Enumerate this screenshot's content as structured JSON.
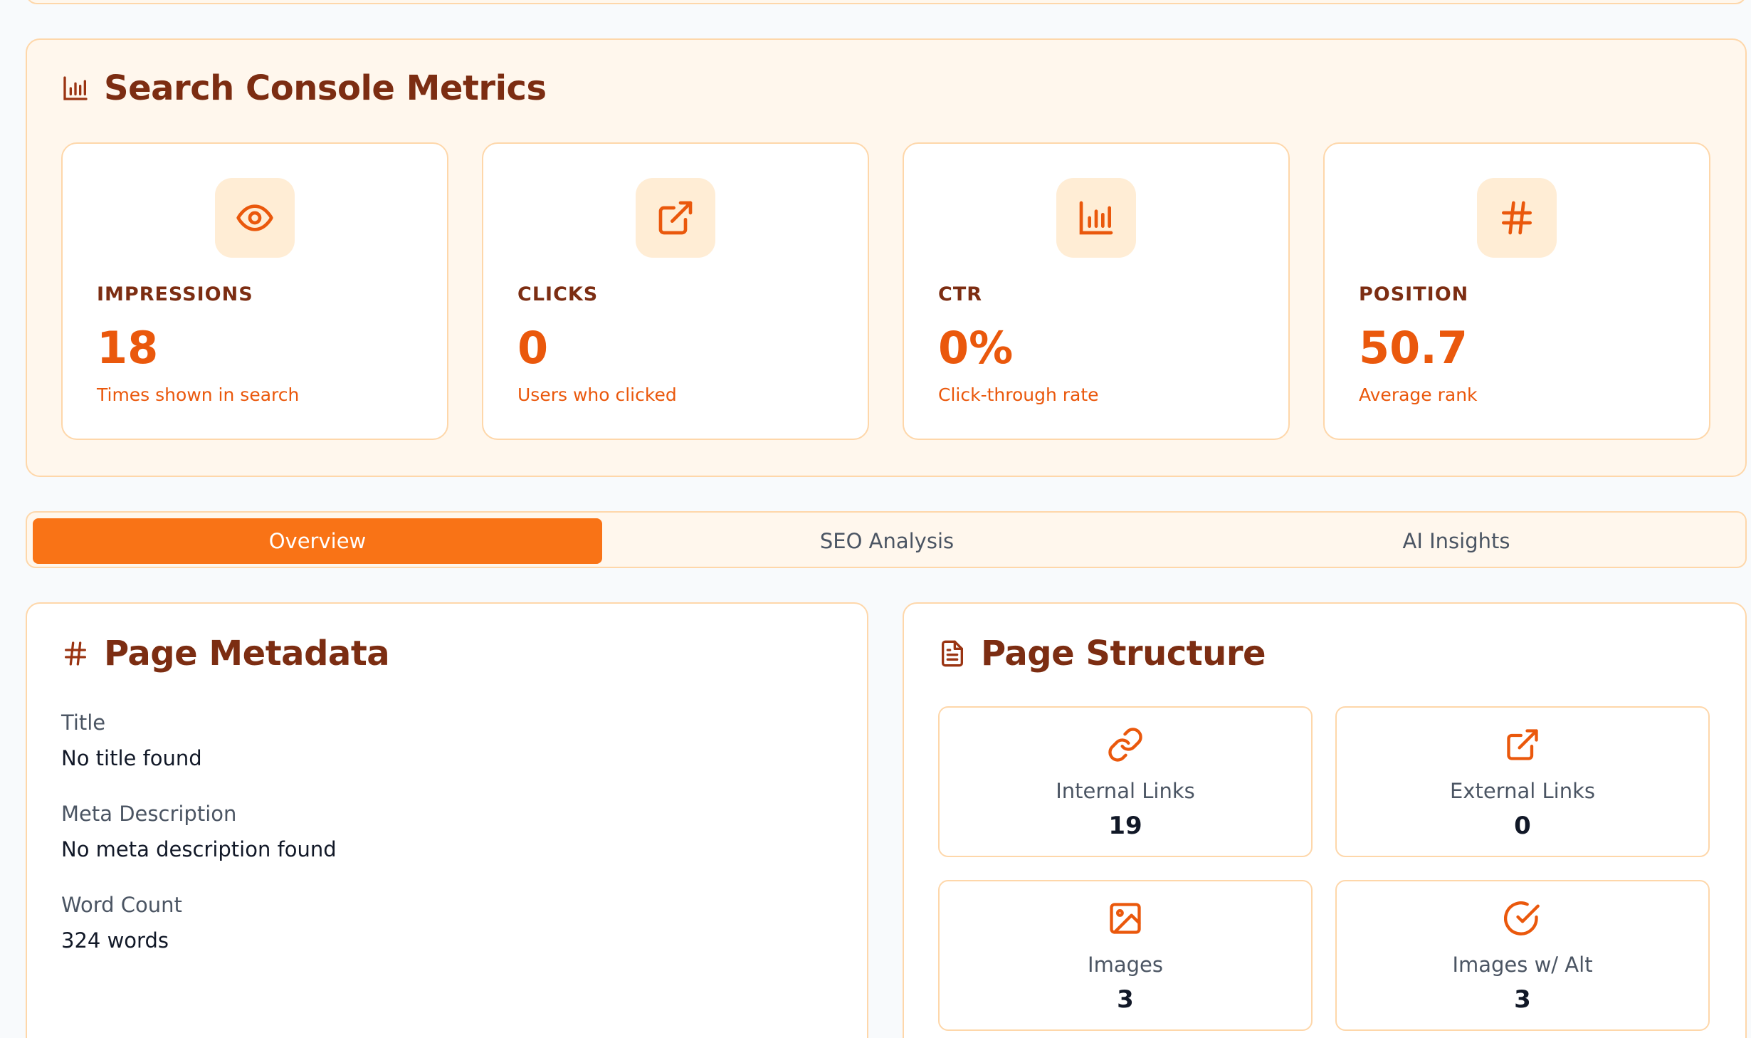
{
  "metrics": {
    "title": "Search Console Metrics",
    "title_icon": "bar-chart-icon",
    "cards": [
      {
        "label": "IMPRESSIONS",
        "value": "18",
        "sub": "Times shown in search",
        "icon": "eye-icon"
      },
      {
        "label": "CLICKS",
        "value": "0",
        "sub": "Users who clicked",
        "icon": "external-link-icon"
      },
      {
        "label": "CTR",
        "value": "0%",
        "sub": "Click-through rate",
        "icon": "bar-chart-icon"
      },
      {
        "label": "POSITION",
        "value": "50.7",
        "sub": "Average rank",
        "icon": "hash-icon"
      }
    ]
  },
  "tabs": [
    {
      "label": "Overview",
      "active": true
    },
    {
      "label": "SEO Analysis",
      "active": false
    },
    {
      "label": "AI Insights",
      "active": false
    }
  ],
  "metadata": {
    "title": "Page Metadata",
    "title_icon": "hash-icon",
    "fields": [
      {
        "label": "Title",
        "value": "No title found"
      },
      {
        "label": "Meta Description",
        "value": "No meta description found"
      },
      {
        "label": "Word Count",
        "value": "324 words"
      }
    ]
  },
  "structure": {
    "title": "Page Structure",
    "title_icon": "document-icon",
    "cards": [
      {
        "label": "Internal Links",
        "value": "19",
        "icon": "link-icon"
      },
      {
        "label": "External Links",
        "value": "0",
        "icon": "external-link-icon"
      },
      {
        "label": "Images",
        "value": "3",
        "icon": "image-icon"
      },
      {
        "label": "Images w/ Alt",
        "value": "3",
        "icon": "check-circle-icon"
      }
    ]
  },
  "colors": {
    "accent": "#f97316",
    "accent_dark": "#ea580c",
    "heading": "#7c2d12",
    "card_border": "#fed7aa",
    "section_bg": "#fff7ed",
    "icon_bg": "#ffedd5"
  }
}
